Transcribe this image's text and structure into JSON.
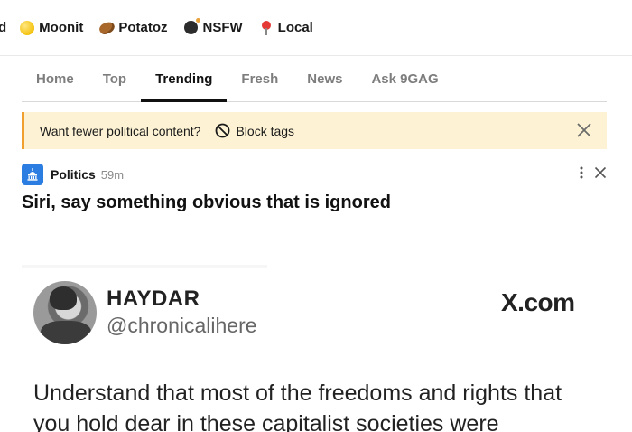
{
  "channels": [
    {
      "label": "d",
      "icon": ""
    },
    {
      "label": "Moonit",
      "icon": "moon-icon"
    },
    {
      "label": "Potatoz",
      "icon": "potato-icon"
    },
    {
      "label": "NSFW",
      "icon": "bomb-icon"
    },
    {
      "label": "Local",
      "icon": "pin-icon"
    }
  ],
  "tabs": [
    {
      "label": "Home",
      "active": false
    },
    {
      "label": "Top",
      "active": false
    },
    {
      "label": "Trending",
      "active": true
    },
    {
      "label": "Fresh",
      "active": false
    },
    {
      "label": "News",
      "active": false
    },
    {
      "label": "Ask 9GAG",
      "active": false
    }
  ],
  "banner": {
    "message": "Want fewer political content?",
    "block_label": "Block tags",
    "accent_color": "#f0a02e",
    "background_color": "#fdf3d4"
  },
  "post": {
    "section": "Politics",
    "time": "59m",
    "title": "Siri, say something obvious that is ignored"
  },
  "tweet": {
    "name": "HAYDAR",
    "handle": "@chronicalihere",
    "source": "X.com",
    "text": "Understand that most of the freedoms and rights that you hold dear in these capitalist societies were"
  }
}
